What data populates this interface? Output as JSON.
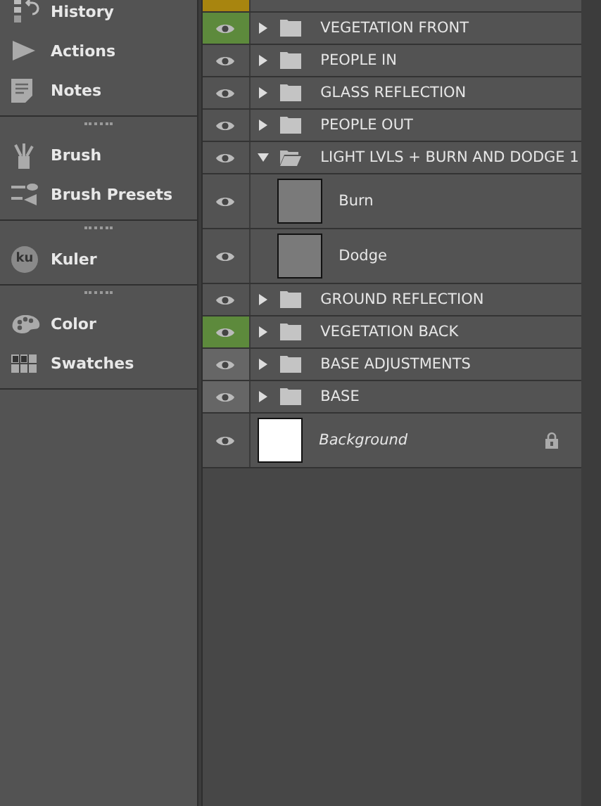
{
  "panel_dock": {
    "groups": [
      {
        "items": [
          {
            "label": "History",
            "kind": "history"
          },
          {
            "label": "Actions",
            "kind": "actions"
          },
          {
            "label": "Notes",
            "kind": "notes"
          }
        ]
      },
      {
        "items": [
          {
            "label": "Brush",
            "kind": "brush"
          },
          {
            "label": "Brush Presets",
            "kind": "brush-presets"
          }
        ]
      },
      {
        "items": [
          {
            "label": "Kuler",
            "kind": "kuler",
            "icon_text": "ku"
          }
        ]
      },
      {
        "items": [
          {
            "label": "Color",
            "kind": "color"
          },
          {
            "label": "Swatches",
            "kind": "swatches"
          }
        ]
      }
    ]
  },
  "layers": {
    "cut_row": {
      "color": "#a8850f"
    },
    "items": [
      {
        "kind": "group",
        "name": "VEGETATION FRONT",
        "expanded": false,
        "color": "#5d8a3c"
      },
      {
        "kind": "group",
        "name": "PEOPLE IN",
        "expanded": false
      },
      {
        "kind": "group",
        "name": "GLASS REFLECTION",
        "expanded": false
      },
      {
        "kind": "group",
        "name": "PEOPLE OUT",
        "expanded": false
      },
      {
        "kind": "group",
        "name": "LIGHT LVLS + BURN AND DODGE 1",
        "expanded": true,
        "children": [
          {
            "kind": "layer",
            "name": "Burn",
            "locked": false,
            "italic": false
          },
          {
            "kind": "layer",
            "name": "Dodge",
            "locked": false,
            "italic": false
          }
        ]
      },
      {
        "kind": "group",
        "name": "GROUND REFLECTION",
        "expanded": false
      },
      {
        "kind": "group",
        "name": "VEGETATION BACK",
        "expanded": false,
        "color": "#5d8a3c"
      },
      {
        "kind": "group",
        "name": "BASE ADJUSTMENTS",
        "expanded": false,
        "color": "#666666"
      },
      {
        "kind": "group",
        "name": "BASE",
        "expanded": false,
        "color": "#666666"
      },
      {
        "kind": "background",
        "name": "Background",
        "locked": true,
        "italic": true
      }
    ]
  }
}
